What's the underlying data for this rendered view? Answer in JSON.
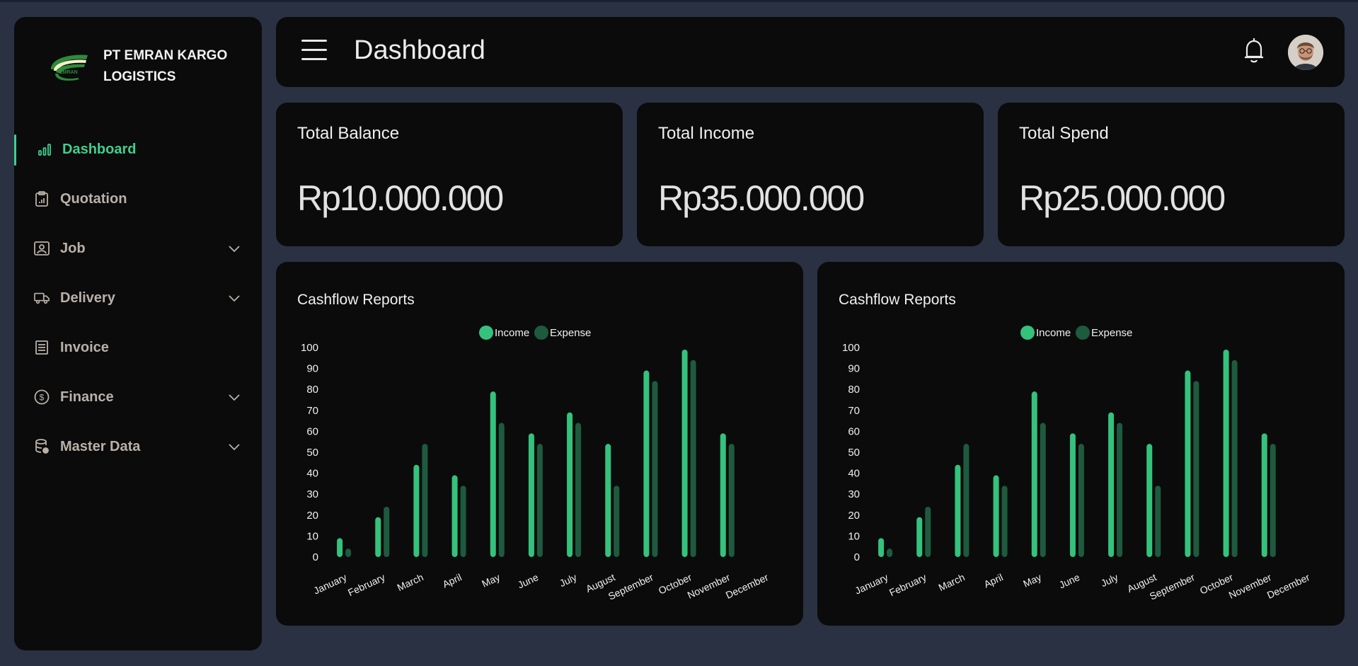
{
  "sidebar": {
    "brand_name": "PT EMRAN KARGO LOGISTICS",
    "logo_text": "EMRAN",
    "items": [
      {
        "label": "Dashboard",
        "icon": "bar-chart-icon",
        "active": true,
        "expandable": false
      },
      {
        "label": "Quotation",
        "icon": "clipboard-icon",
        "active": false,
        "expandable": false
      },
      {
        "label": "Job",
        "icon": "id-card-icon",
        "active": false,
        "expandable": true
      },
      {
        "label": "Delivery",
        "icon": "truck-icon",
        "active": false,
        "expandable": true
      },
      {
        "label": "Invoice",
        "icon": "document-icon",
        "active": false,
        "expandable": false
      },
      {
        "label": "Finance",
        "icon": "dollar-circle-icon",
        "active": false,
        "expandable": true
      },
      {
        "label": "Master Data",
        "icon": "database-icon",
        "active": false,
        "expandable": true
      }
    ]
  },
  "header": {
    "title": "Dashboard",
    "menu_icon": "hamburger-icon",
    "notification_icon": "bell-icon"
  },
  "stats": [
    {
      "title": "Total Balance",
      "value": "Rp10.000.000"
    },
    {
      "title": "Total Income",
      "value": "Rp35.000.000"
    },
    {
      "title": "Total Spend",
      "value": "Rp25.000.000"
    }
  ],
  "colors": {
    "accent": "#3fcf8e",
    "income": "#34c27c",
    "expense": "#1e5a3e",
    "background": "#2a3142",
    "panel": "#0b0b0c"
  },
  "chart_data": [
    {
      "type": "bar",
      "title": "Cashflow Reports",
      "legend_position": "top",
      "categories": [
        "January",
        "February",
        "March",
        "April",
        "May",
        "June",
        "July",
        "August",
        "September",
        "October",
        "November",
        "December"
      ],
      "series": [
        {
          "name": "Income",
          "values": [
            9,
            19,
            44,
            39,
            79,
            59,
            69,
            54,
            89,
            99,
            59,
            null
          ]
        },
        {
          "name": "Expense",
          "values": [
            4,
            24,
            54,
            34,
            64,
            54,
            64,
            34,
            84,
            94,
            54,
            null
          ]
        }
      ],
      "ylim": [
        0,
        100
      ],
      "yticks": [
        0,
        10,
        20,
        30,
        40,
        50,
        60,
        70,
        80,
        90,
        100
      ],
      "grid": false
    },
    {
      "type": "bar",
      "title": "Cashflow Reports",
      "legend_position": "top",
      "categories": [
        "January",
        "February",
        "March",
        "April",
        "May",
        "June",
        "July",
        "August",
        "September",
        "October",
        "November",
        "December"
      ],
      "series": [
        {
          "name": "Income",
          "values": [
            9,
            19,
            44,
            39,
            79,
            59,
            69,
            54,
            89,
            99,
            59,
            null
          ]
        },
        {
          "name": "Expense",
          "values": [
            4,
            24,
            54,
            34,
            64,
            54,
            64,
            34,
            84,
            94,
            54,
            null
          ]
        }
      ],
      "ylim": [
        0,
        100
      ],
      "yticks": [
        0,
        10,
        20,
        30,
        40,
        50,
        60,
        70,
        80,
        90,
        100
      ],
      "grid": false
    }
  ]
}
